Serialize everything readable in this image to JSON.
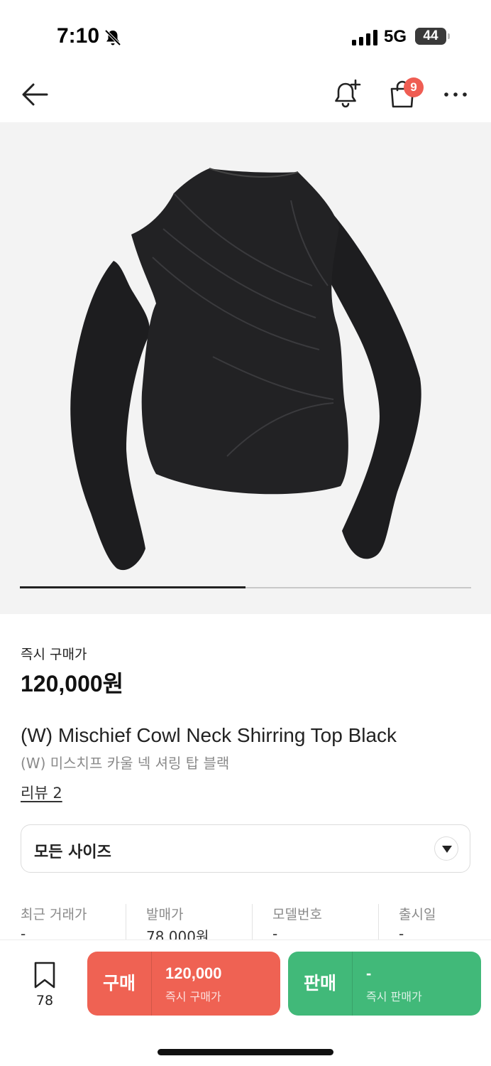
{
  "status_bar": {
    "time": "7:10",
    "network": "5G",
    "battery": "44",
    "battery_level": 0.44
  },
  "nav": {
    "back_icon": "arrow-left-icon",
    "alert_icon": "bell-plus-icon",
    "bag_icon": "shopping-bag-icon",
    "bag_count": "9",
    "more_icon": "more-horizontal-icon"
  },
  "hero": {
    "carousel_progress": 0.5
  },
  "product": {
    "price_label": "즉시 구매가",
    "price": "120,000원",
    "title_en": "(W) Mischief Cowl Neck Shirring Top Black",
    "title_ko": "(W) 미스치프 카울 넥 셔링 탑 블랙",
    "review_link": "리뷰 2"
  },
  "size_select": {
    "selected": "모든 사이즈",
    "chevron_icon": "chevron-down-icon"
  },
  "stats": [
    {
      "label": "최근 거래가",
      "value": "-"
    },
    {
      "label": "발매가",
      "value": "78,000원"
    },
    {
      "label": "모델번호",
      "value": "-"
    },
    {
      "label": "출시일",
      "value": "-"
    }
  ],
  "actions": {
    "wish_icon": "bookmark-icon",
    "wish_count": "78",
    "buy": {
      "tag": "구매",
      "price": "120,000",
      "sub": "즉시 구매가"
    },
    "sell": {
      "tag": "판매",
      "price": "-",
      "sub": "즉시 판매가"
    }
  },
  "colors": {
    "buy": "#ef6253",
    "sell": "#41b979",
    "badge": "#ef5d53"
  }
}
